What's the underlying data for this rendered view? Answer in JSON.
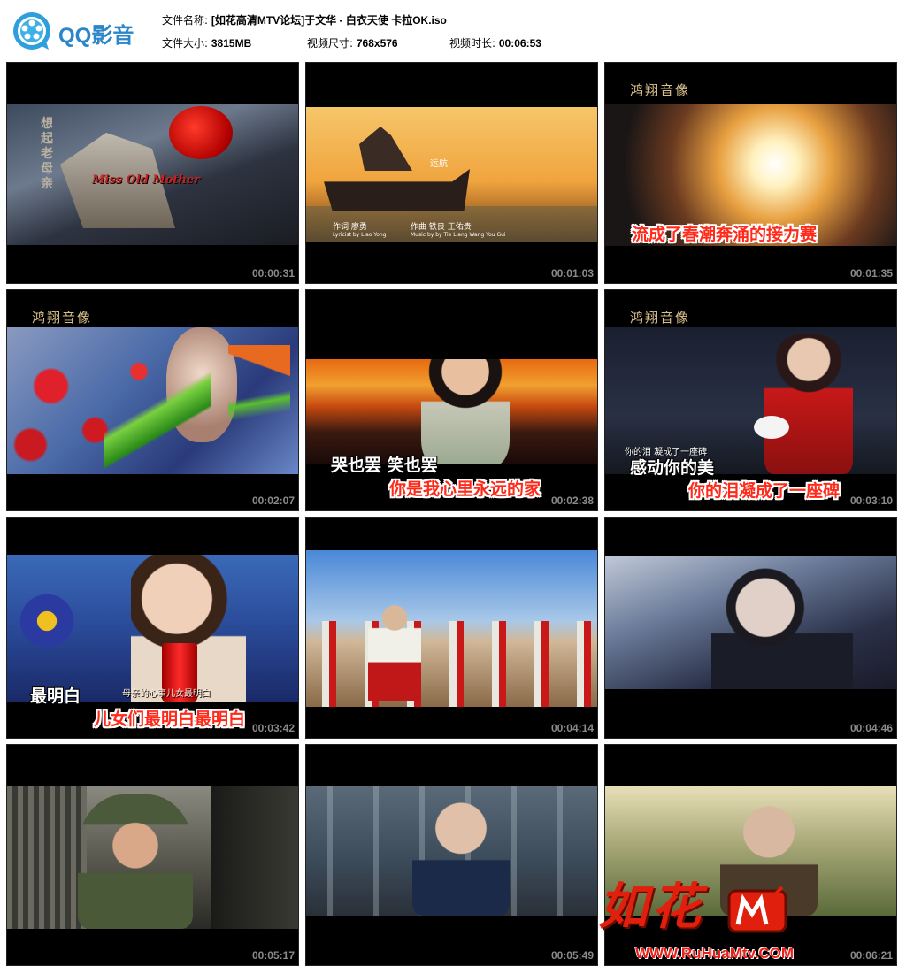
{
  "app": {
    "name": "QQ影音"
  },
  "file": {
    "name_label": "文件名称:",
    "name_value": "[如花高清MTV论坛]于文华 - 白衣天使 卡拉OK.iso",
    "size_label": "文件大小:",
    "size_value": "3815MB",
    "dims_label": "视频尺寸:",
    "dims_value": "768x576",
    "duration_label": "视频时长:",
    "duration_value": "00:06:53"
  },
  "thumbs": [
    {
      "time": "00:00:31",
      "overlay": "Miss Old Mother",
      "vertical": "想起老母亲"
    },
    {
      "time": "00:01:03",
      "credit1": "作词 廖勇",
      "credit1_en": "Lyricist by Liao Yong",
      "credit2": "作曲 铁良 王佑贵",
      "credit2_en": "Music by by Tie Liang  Wang You Gui",
      "ship": "远航"
    },
    {
      "time": "00:01:35",
      "studio": "鸿翔音像",
      "sub": "流成了春潮奔涌的接力赛"
    },
    {
      "time": "00:02:07",
      "studio": "鸿翔音像"
    },
    {
      "time": "00:02:38",
      "sub_white": "哭也罢  笑也罢",
      "sub": "你是我心里永远的家"
    },
    {
      "time": "00:03:10",
      "studio": "鸿翔音像",
      "sub_small": "你的泪   凝成了一座碑",
      "sub_white": "感动你的美",
      "sub": "你的泪凝成了一座碑"
    },
    {
      "time": "00:03:42",
      "sub_small": "母亲的心事儿女最明白",
      "sub_white": "最明白",
      "sub": "儿女们最明白最明白"
    },
    {
      "time": "00:04:14"
    },
    {
      "time": "00:04:46"
    },
    {
      "time": "00:05:17"
    },
    {
      "time": "00:05:49"
    },
    {
      "time": "00:06:21"
    }
  ],
  "watermark": {
    "logo": "如花",
    "url": "WWW.RuHuaMtv.COM"
  }
}
